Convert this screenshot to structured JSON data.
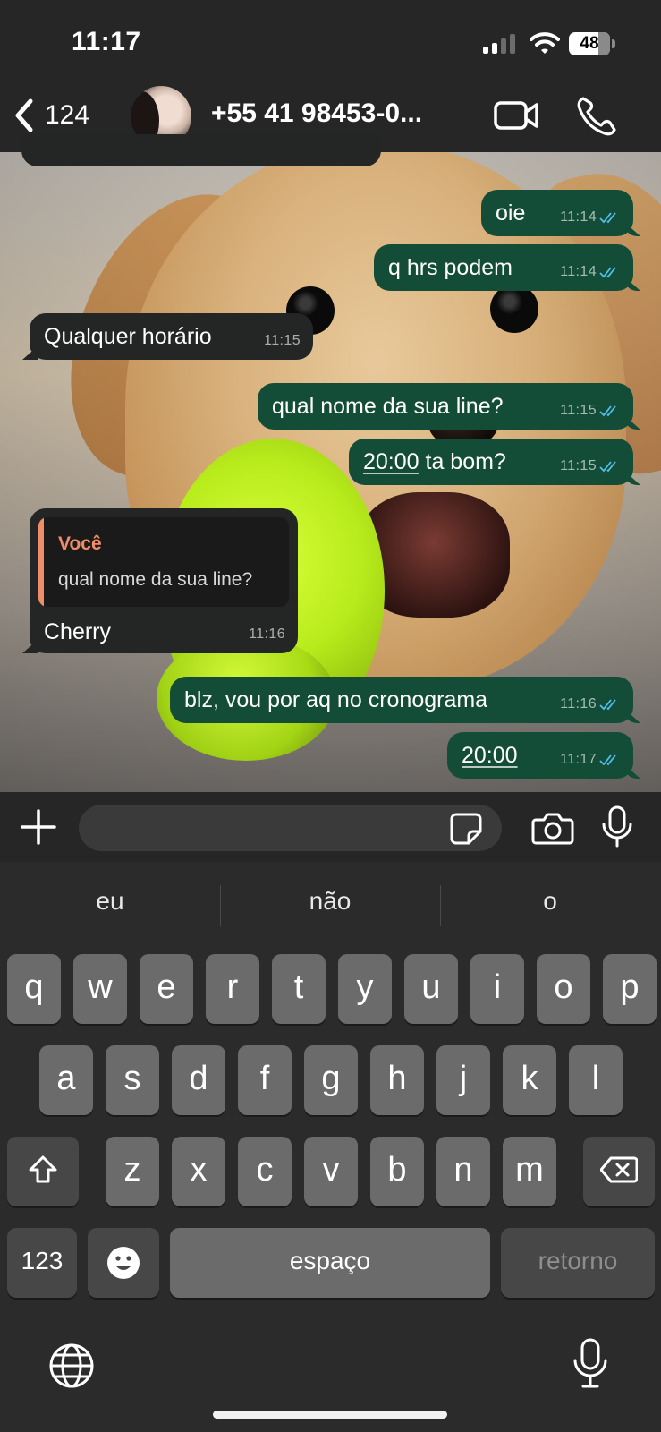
{
  "status_bar": {
    "time": "11:17",
    "battery": "48"
  },
  "header": {
    "back_count": "124",
    "contact_name": "+55 41 98453-0..."
  },
  "messages": [
    {
      "text": "oie",
      "time": "11:14"
    },
    {
      "text": "q hrs podem",
      "time": "11:14"
    },
    {
      "text": "Qualquer horário",
      "time": "11:15"
    },
    {
      "text": "qual nome da sua line?",
      "time": "11:15"
    },
    {
      "text_link": "20:00",
      "text_rest": " ta bom?",
      "time": "11:15"
    },
    {
      "reply_author": "Você",
      "reply_text": "qual nome da sua line?",
      "text": "Cherry",
      "time": "11:16"
    },
    {
      "text": "blz, vou por aq no cronograma",
      "time": "11:16"
    },
    {
      "text_link": "20:00",
      "time": "11:17"
    }
  ],
  "composer": {
    "placeholder": ""
  },
  "keyboard": {
    "suggestions": [
      "eu",
      "não",
      "o"
    ],
    "row1": [
      "q",
      "w",
      "e",
      "r",
      "t",
      "y",
      "u",
      "i",
      "o",
      "p"
    ],
    "row2": [
      "a",
      "s",
      "d",
      "f",
      "g",
      "h",
      "j",
      "k",
      "l"
    ],
    "row3": [
      "z",
      "x",
      "c",
      "v",
      "b",
      "n",
      "m"
    ],
    "numbers_key": "123",
    "space_key": "espaço",
    "return_key": "retorno"
  },
  "colors": {
    "outgoing_bubble": "#134d37",
    "incoming_bubble": "#242626",
    "reply_accent": "#ef8d6a",
    "read_ticks": "#53bdeb"
  }
}
